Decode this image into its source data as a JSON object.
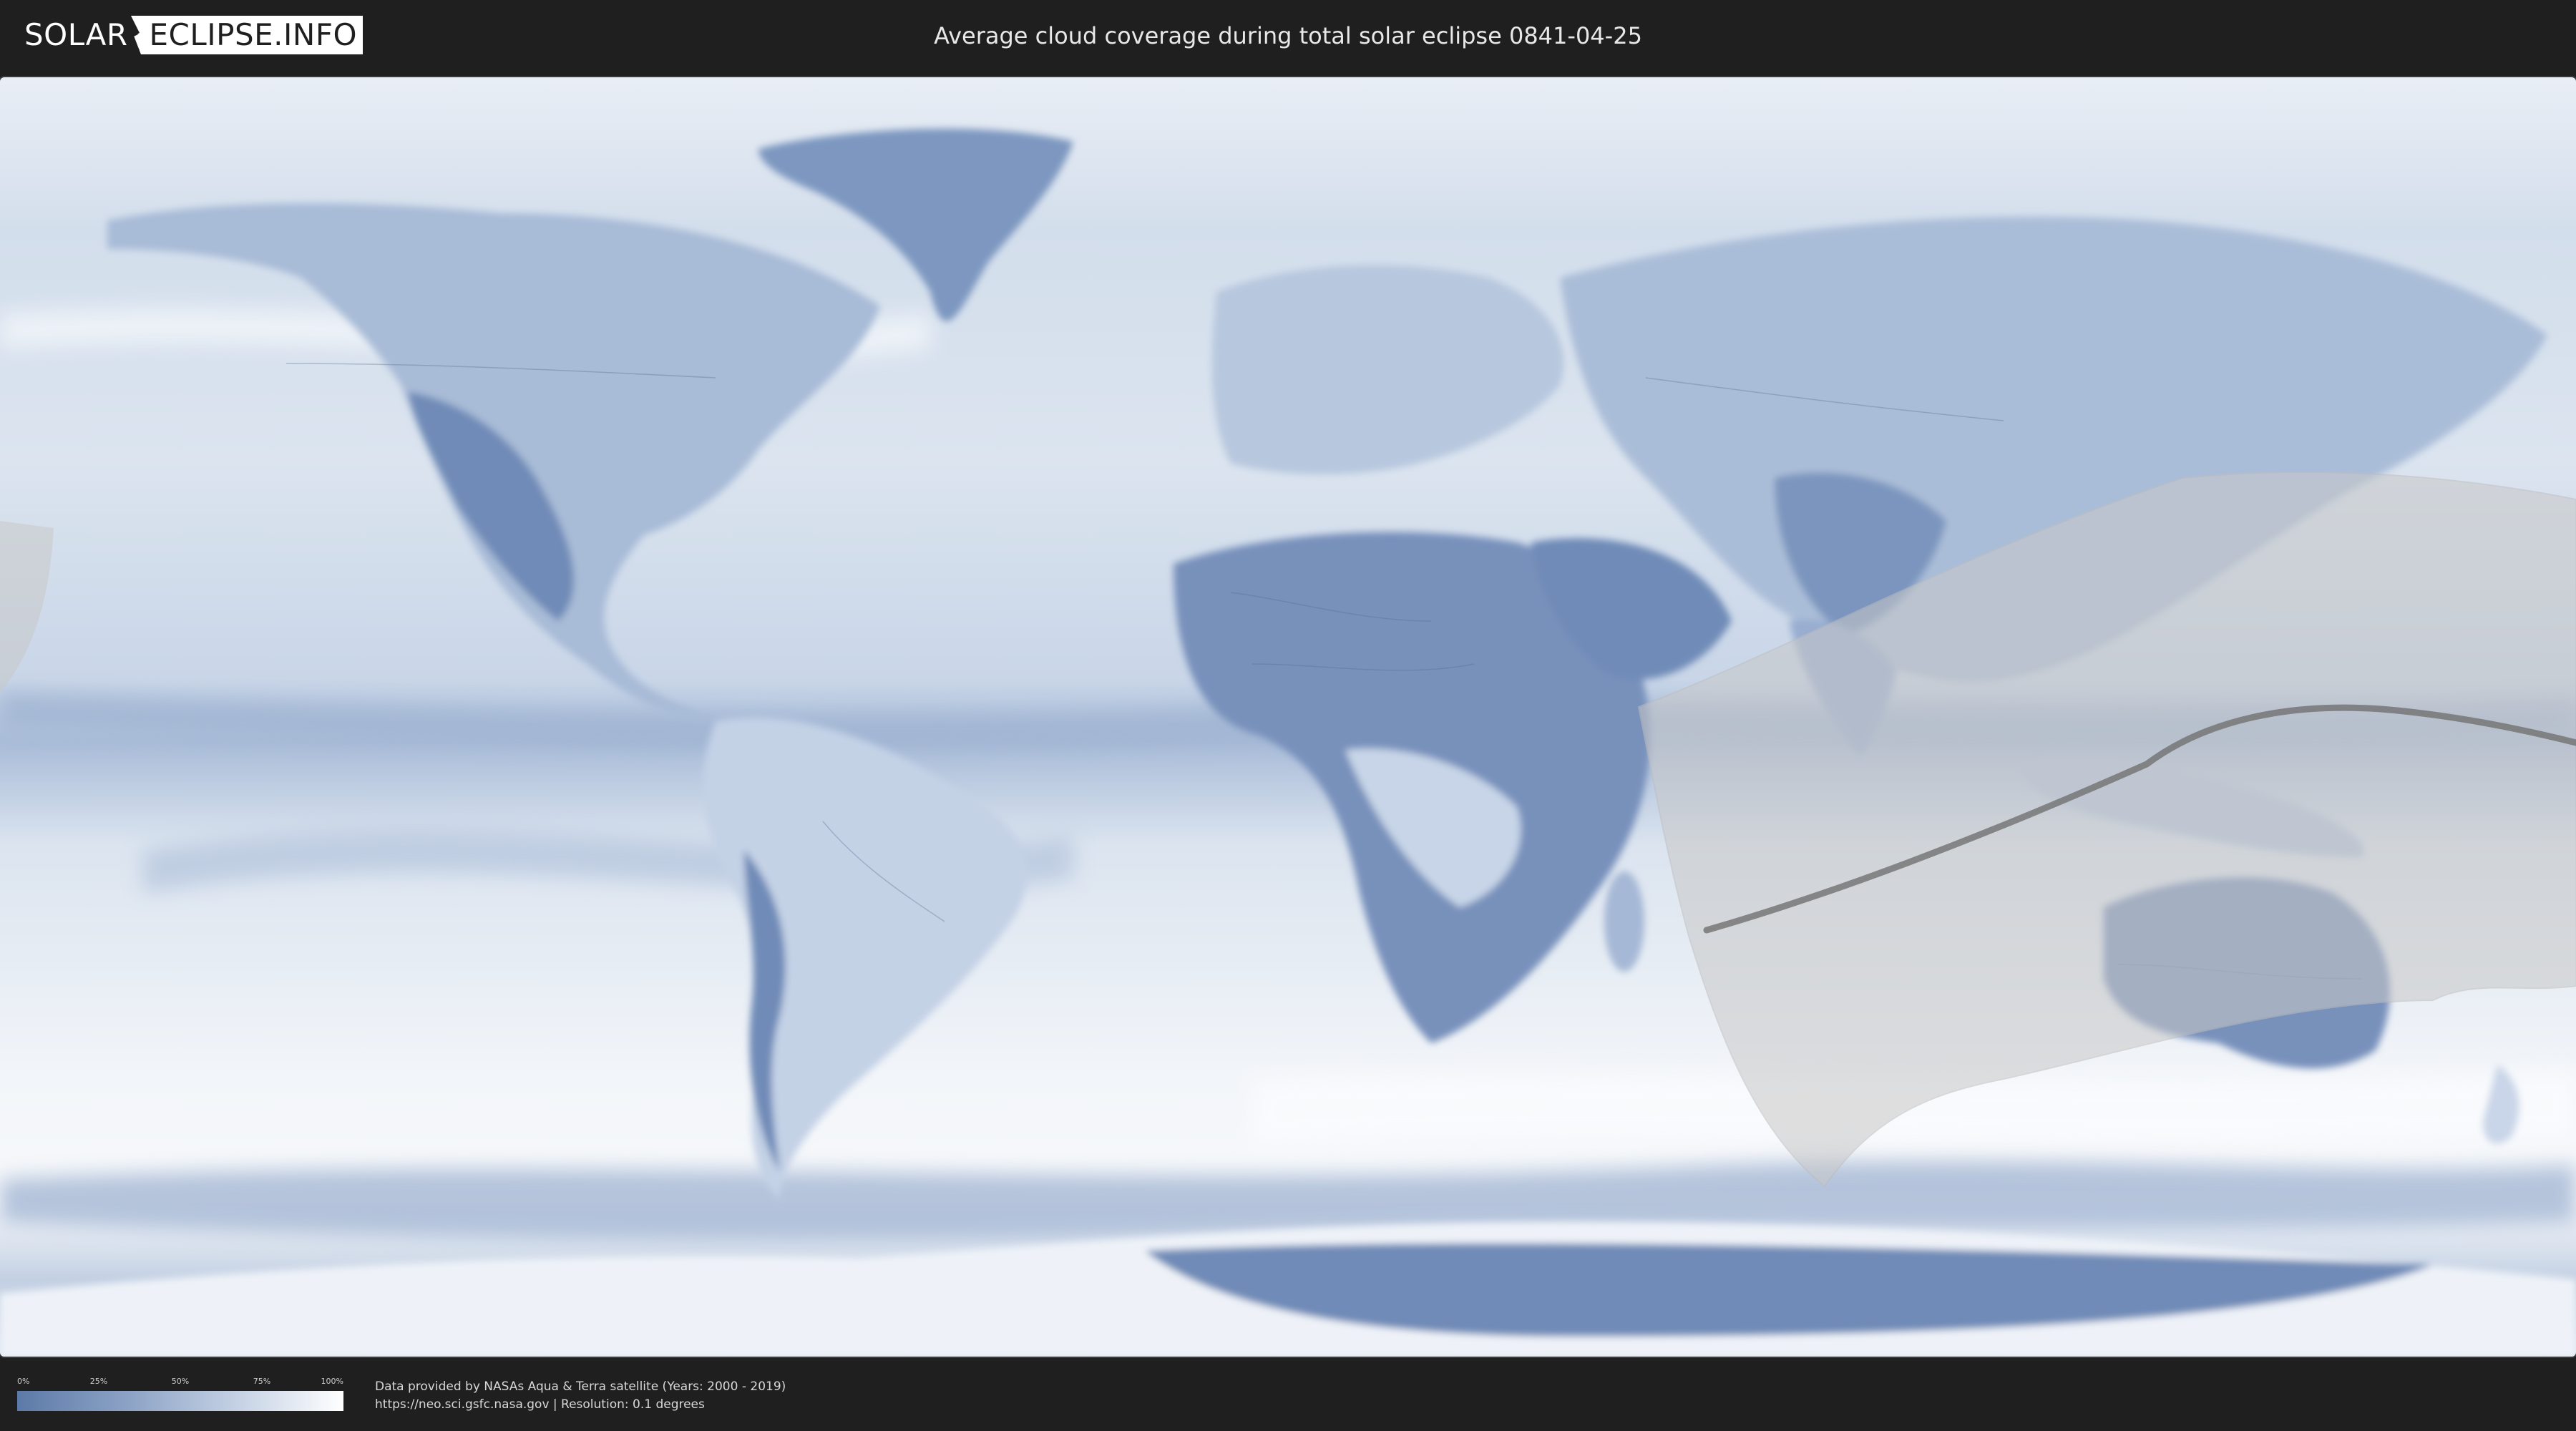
{
  "header": {
    "logo_left": "SOLAR",
    "logo_right": "ECLIPSE.INFO",
    "title": "Average cloud coverage during total solar eclipse 0841-04-25"
  },
  "legend": {
    "ticks": [
      "0%",
      "25%",
      "50%",
      "75%",
      "100%"
    ],
    "colors": {
      "low": "#5c7aa8",
      "high": "#ffffff"
    }
  },
  "footer": {
    "credit_line": "Data provided by NASAs Aqua & Terra satellite (Years: 2000 - 2019)",
    "source_line": "https://neo.sci.gsfc.nasa.gov | Resolution: 0.1 degrees"
  },
  "colors": {
    "background": "#1f1f1f",
    "ocean_cloud": "#dfe7f1",
    "clear_land": "#6f8bb6",
    "eclipse_zone": "#cfcfcf",
    "central_path": "#6e6e6e"
  }
}
